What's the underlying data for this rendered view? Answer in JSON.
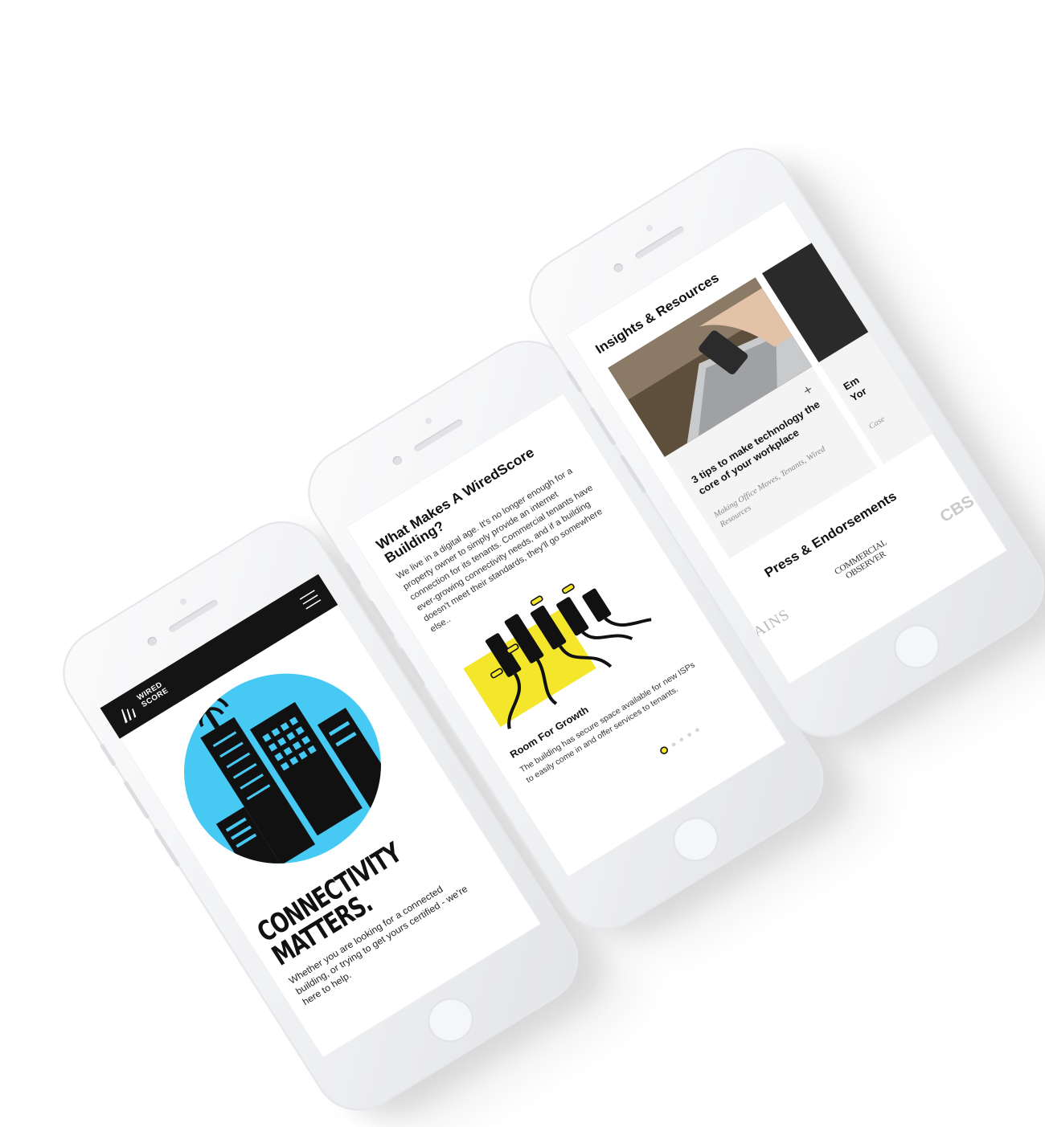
{
  "screens": {
    "home": {
      "logo_line1": "WIRED",
      "logo_line2": "SCORE",
      "headline_1": "CONNECTIVITY",
      "headline_2": "MATTERS.",
      "body": "Whether you are looking for a connected building, or trying to get yours certified - we're here to help.",
      "menu_icon": "hamburger-icon",
      "colors": {
        "circle": "#46c9f3",
        "bar": "#141414"
      }
    },
    "about": {
      "title": "What Makes A WiredScore Building?",
      "body": "We live in a digital age. It's no longer enough for a property owner to simply provide an internet connection for its tenants. Commercial tenants have ever-growing connectivity needs, and if a building doesn't meet their standards, they'll go somewhere else..",
      "feature_title": "Room For Growth",
      "feature_body": "The building has secure space available for new ISPs to easily come in and offer services to tenants.",
      "slide_count": 5,
      "active_slide": 1,
      "colors": {
        "accent": "#f4e62a"
      }
    },
    "insights": {
      "title": "Insights & Resources",
      "card_title": "3 tips to make technology the core of your workplace",
      "card_meta": "Making Office Moves, Tenants, Wired Resources",
      "card_plus": "+",
      "card2_title_l1": "Em",
      "card2_title_l2": "Yor",
      "card2_meta": "Case",
      "press_title": "Press & Endorsements",
      "logos": {
        "crains": "RAINS",
        "co_line1": "COMMERCIAL",
        "co_line2": "OBSERVER",
        "cbs": "CBS"
      }
    }
  }
}
